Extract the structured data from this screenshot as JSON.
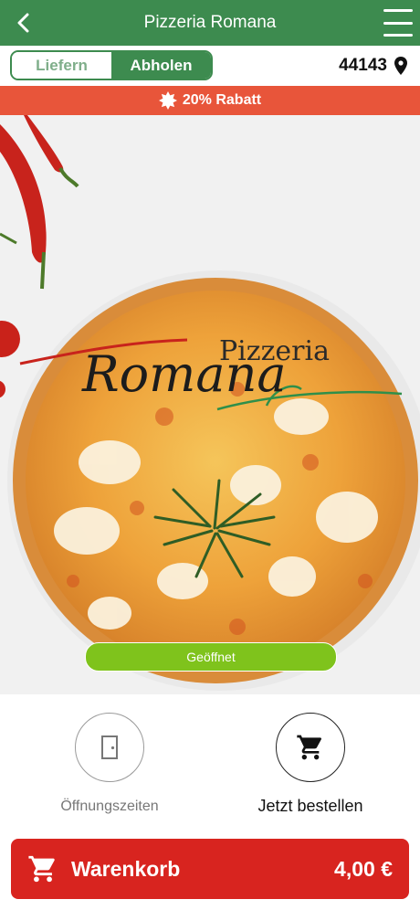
{
  "header": {
    "title": "Pizzeria Romana",
    "back_icon": "chevron-left-icon",
    "menu_icon": "hamburger-menu-icon",
    "background_color": "#3d8b4f"
  },
  "mode_toggle": {
    "delivery_label": "Liefern",
    "pickup_label": "Abholen",
    "selected": "Abholen"
  },
  "location": {
    "zip": "44143",
    "icon": "map-pin-icon"
  },
  "promo": {
    "icon": "badge-icon",
    "text": "20% Rabatt",
    "background_color": "#e8553a"
  },
  "hero": {
    "logo_line1": "Pizzeria",
    "logo_line2": "Romana",
    "status": "Geöffnet",
    "status_color": "#7fc31c"
  },
  "actions": {
    "hours_label": "Öffnungszeiten",
    "hours_icon": "door-icon",
    "order_label": "Jetzt bestellen",
    "order_icon": "shopping-cart-icon"
  },
  "cart": {
    "label": "Warenkorb",
    "amount": "4,00 €",
    "icon": "shopping-cart-icon",
    "background_color": "#d8241f"
  }
}
